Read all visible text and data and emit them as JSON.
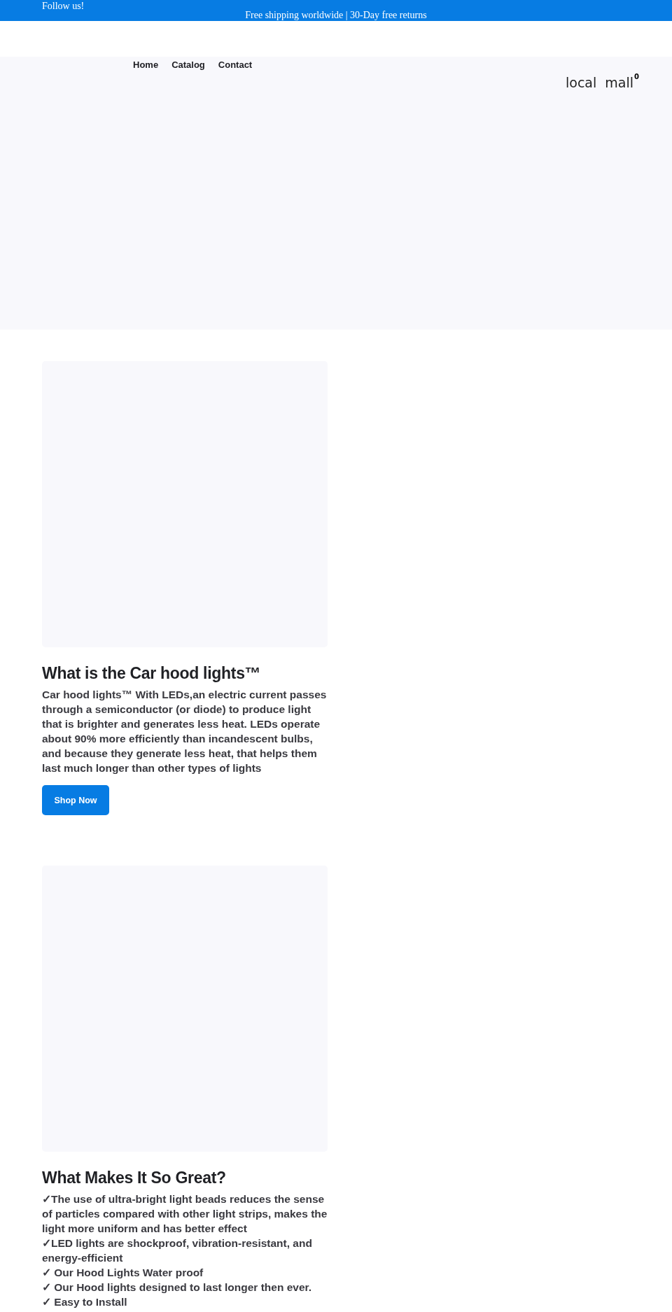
{
  "announcement_bar": {
    "follow": "Follow us!",
    "message": "Free shipping worldwide | 30-Day free returns"
  },
  "nav": {
    "items": [
      {
        "label": "Home"
      },
      {
        "label": "Catalog"
      },
      {
        "label": "Contact"
      }
    ],
    "logo": "local  mall",
    "cart_count": "0"
  },
  "sections": [
    {
      "kind": "paragraph",
      "heading": "What is the Car hood lights™",
      "text": "Car hood lights™ With LEDs,an electric current passes through a semiconductor (or diode) to produce light that is brighter and generates less heat. LEDs operate about 90% more efficiently than incandescent bulbs, and because they generate less heat, that helps them last much longer than other types of lights",
      "button": "Shop Now"
    },
    {
      "kind": "list",
      "heading": "What Makes It So Great?",
      "lines": [
        "✓The use of ultra-bright light beads reduces the sense of particles compared with other light strips, makes the light more uniform and has better effect",
        "✓LED lights are shockproof, vibration-resistant, and energy-efficient",
        "✓ Our Hood Lights Water proof",
        "✓ Our Hood lights designed to last longer then ever.",
        "✓ Easy to Install"
      ]
    }
  ]
}
